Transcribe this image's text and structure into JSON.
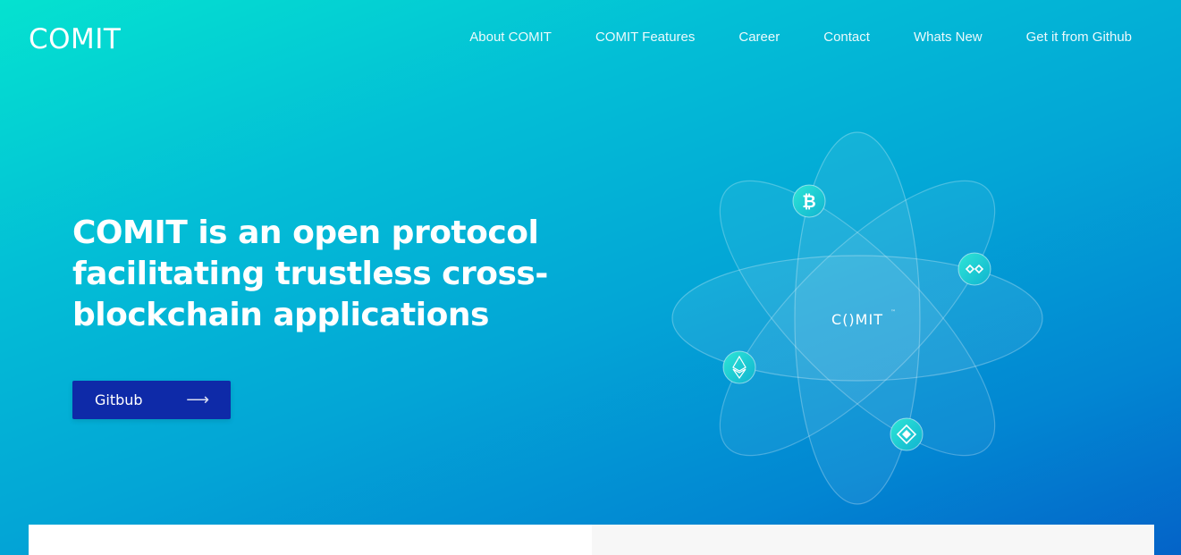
{
  "nav": {
    "logo": "COMIT",
    "links": [
      "About COMIT",
      "COMIT Features",
      "Career",
      "Contact",
      "Whats New",
      "Get it from Github"
    ]
  },
  "hero": {
    "title": "COMIT is an open protocol facilitating trustless cross-blockchain applications",
    "button_label": "Gitbub",
    "button_icon": "arrow-right-icon"
  },
  "illustration": {
    "center_logo": "C()MIT",
    "trademark": "™",
    "coins": [
      "bitcoin-icon",
      "ethereum-icon",
      "infinity-coin-icon",
      "diamond-coin-icon"
    ]
  },
  "colors": {
    "gradient_start": "#05e2d0",
    "gradient_end": "#0463c8",
    "button_bg": "#0e2aa8",
    "coin_accent": "#1fd3cf"
  }
}
